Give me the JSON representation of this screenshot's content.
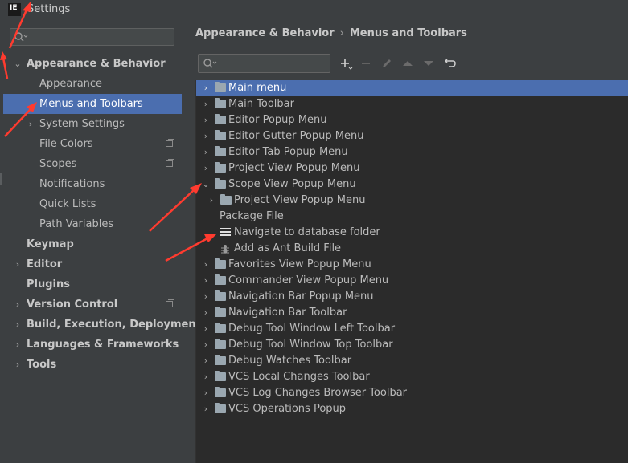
{
  "window": {
    "title": "Settings",
    "app_icon": "IE"
  },
  "sidebar": {
    "search_placeholder": "",
    "items": [
      {
        "label": "Appearance & Behavior",
        "expanded": true
      },
      {
        "label": "Appearance"
      },
      {
        "label": "Menus and Toolbars",
        "selected": true
      },
      {
        "label": "System Settings"
      },
      {
        "label": "File Colors"
      },
      {
        "label": "Scopes"
      },
      {
        "label": "Notifications"
      },
      {
        "label": "Quick Lists"
      },
      {
        "label": "Path Variables"
      },
      {
        "label": "Keymap"
      },
      {
        "label": "Editor"
      },
      {
        "label": "Plugins"
      },
      {
        "label": "Version Control"
      },
      {
        "label": "Build, Execution, Deployment"
      },
      {
        "label": "Languages & Frameworks"
      },
      {
        "label": "Tools"
      }
    ]
  },
  "breadcrumb": {
    "parent": "Appearance & Behavior",
    "separator": "›",
    "current": "Menus and Toolbars"
  },
  "toolbar": {
    "search_placeholder": "",
    "buttons": [
      "add-icon",
      "remove-icon",
      "edit-icon",
      "move-up-icon",
      "move-down-icon",
      "restore-icon"
    ]
  },
  "tree": {
    "rows": [
      {
        "label": "Main menu",
        "selected": true
      },
      {
        "label": "Main Toolbar"
      },
      {
        "label": "Editor Popup Menu"
      },
      {
        "label": "Editor Gutter Popup Menu"
      },
      {
        "label": "Editor Tab Popup Menu"
      },
      {
        "label": "Project View Popup Menu"
      },
      {
        "label": "Scope View Popup Menu",
        "expanded": true
      },
      {
        "label": "Project View Popup Menu"
      },
      {
        "label": "Package File"
      },
      {
        "label": "Navigate to database folder"
      },
      {
        "label": "Add as Ant Build File"
      },
      {
        "label": "Favorites View Popup Menu"
      },
      {
        "label": "Commander View Popup Menu"
      },
      {
        "label": "Navigation Bar Popup Menu"
      },
      {
        "label": "Navigation Bar Toolbar"
      },
      {
        "label": "Debug Tool Window Left Toolbar"
      },
      {
        "label": "Debug Tool Window Top Toolbar"
      },
      {
        "label": "Debug Watches Toolbar"
      },
      {
        "label": "VCS Local Changes Toolbar"
      },
      {
        "label": "VCS Log Changes Browser Toolbar"
      },
      {
        "label": "VCS Operations Popup"
      }
    ]
  },
  "colors": {
    "background": "#3c3f41",
    "tree_background": "#2b2b2b",
    "selection": "#4b6eaf",
    "annotation_arrow": "#ff3b2f"
  }
}
